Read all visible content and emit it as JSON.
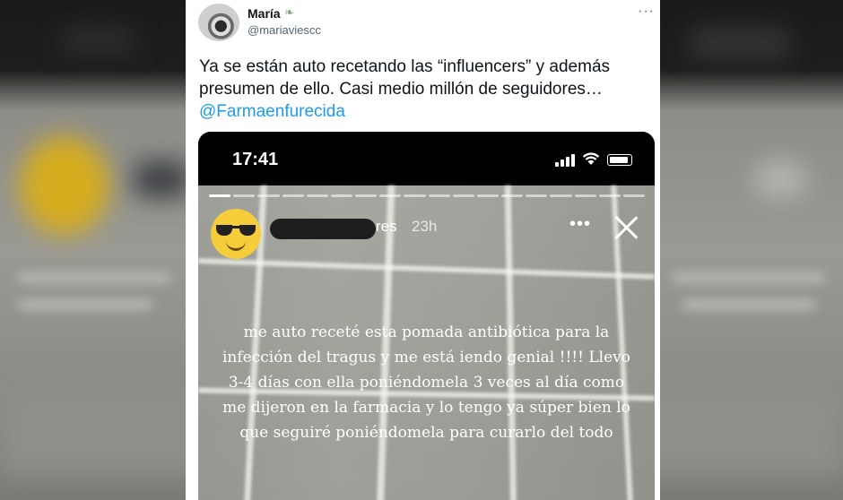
{
  "tweet": {
    "author_name": "María",
    "author_name_icon": "leaf-icon",
    "author_handle": "@mariaviescc",
    "more_icon": "more-horizontal-icon",
    "text": "Ya se están auto recetando las “influencers” y además presumen de ello. Casi medio millón de seguidores…",
    "mention": "@Farmaenfurecida"
  },
  "story_screenshot": {
    "status_time": "17:41",
    "status_icons": [
      "cellular-signal-icon",
      "wifi-icon",
      "battery-icon"
    ],
    "username_visible_suffix": "res",
    "username_redacted": true,
    "post_age": "23h",
    "more_icon": "more-horizontal-icon",
    "close_icon": "close-icon",
    "avatar_emoji": "sunglasses-face-emoji",
    "progress_segments_total": 18,
    "progress_segments_done": 1,
    "caption": "me auto receté esta pomada antibiótica para la infección del tragus y me está iendo genial !!!! Llevo 3-4 días con ella poniéndomela 3 veces al día como me dijeron en la farmacia y lo tengo ya súper bien lo que seguiré poniéndomela para curarlo del todo"
  },
  "colors": {
    "link": "#1d9bf0",
    "text_primary": "#0f1419",
    "text_secondary": "#536471"
  }
}
